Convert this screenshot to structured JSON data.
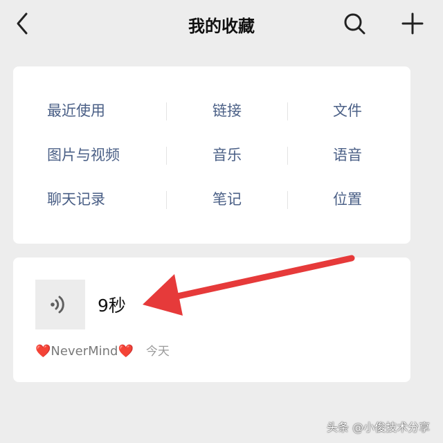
{
  "header": {
    "title": "我的收藏",
    "back_icon": "chevron-left-icon",
    "search_icon": "search-icon",
    "add_icon": "plus-icon"
  },
  "categories": [
    [
      "最近使用",
      "链接",
      "文件"
    ],
    [
      "图片与视频",
      "音乐",
      "语音"
    ],
    [
      "聊天记录",
      "笔记",
      "位置"
    ]
  ],
  "item": {
    "type_icon": "voice-icon",
    "duration": "9秒",
    "source_name": "NeverMind",
    "source_emoji": "❤️",
    "time": "今天"
  },
  "annotation": {
    "arrow_color": "#e63a3a"
  },
  "watermark": "头条 @小俊技术分享",
  "colors": {
    "background": "#ededed",
    "card": "#ffffff",
    "category_text": "#4a5f86"
  }
}
